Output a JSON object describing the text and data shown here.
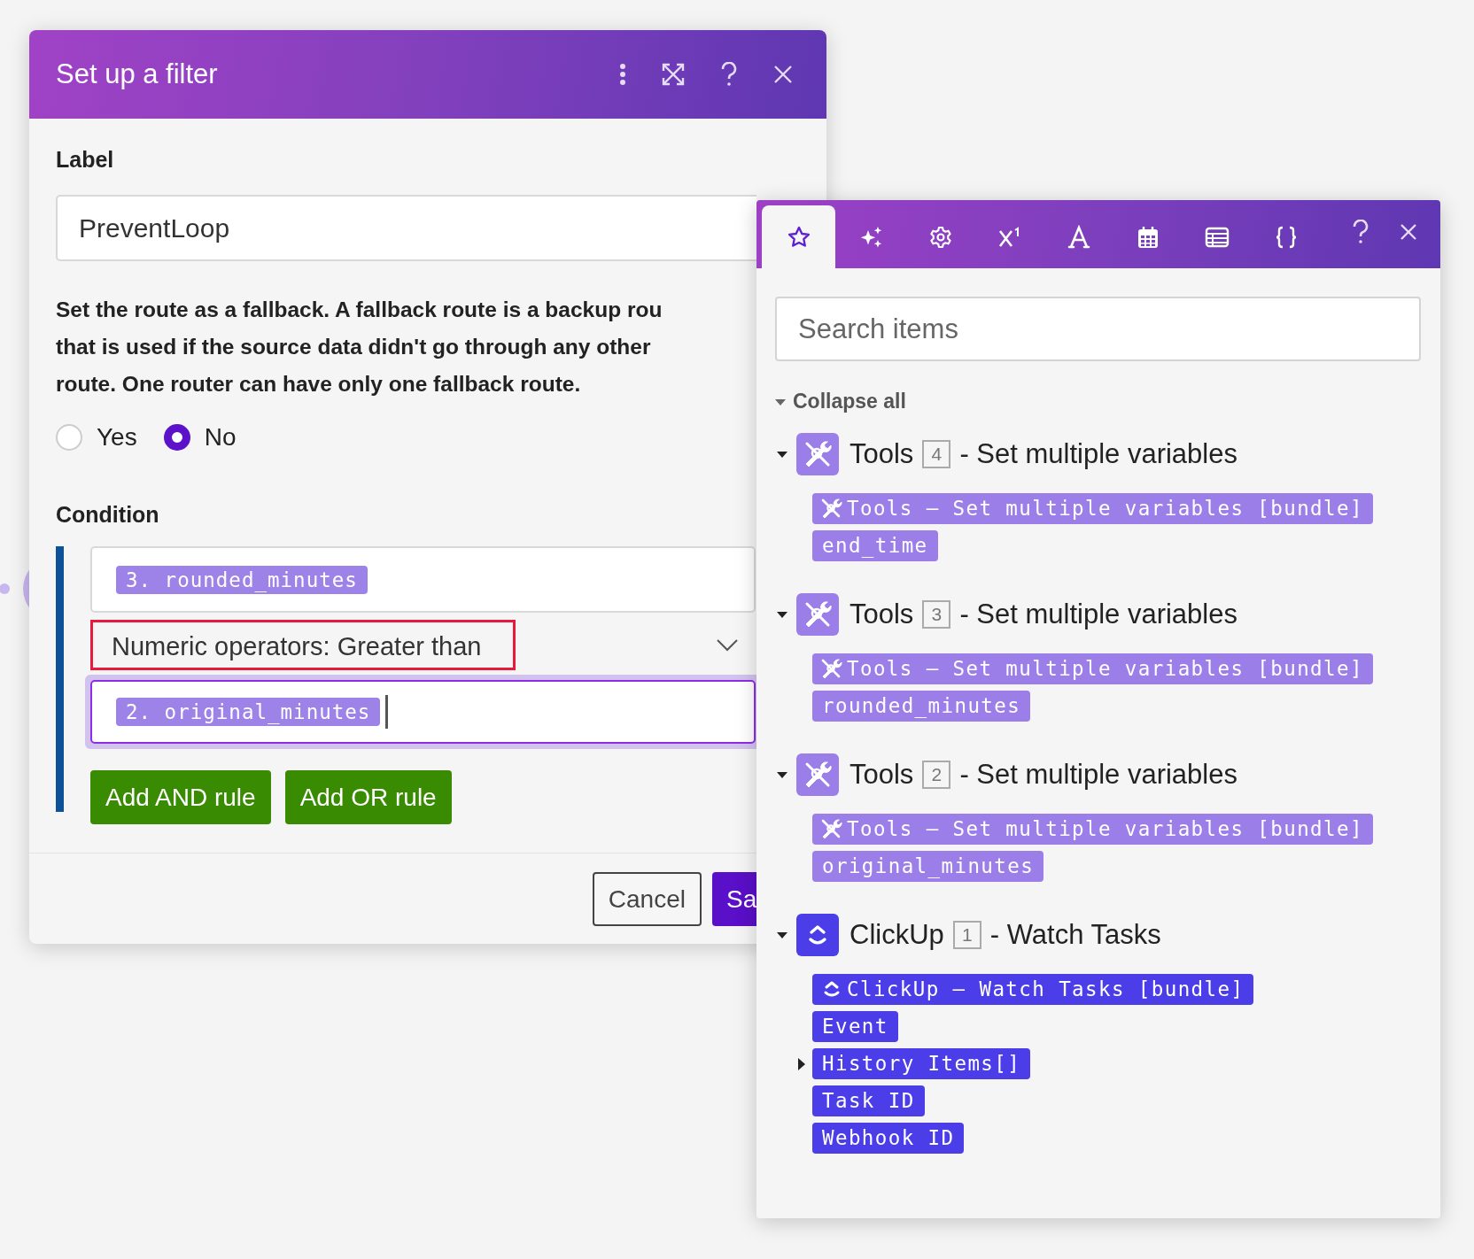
{
  "dialog": {
    "title": "Set up a filter",
    "label": {
      "caption": "Label",
      "value": "PreventLoop"
    },
    "fallback": {
      "lines": [
        "Set the route as a fallback. A fallback route is a backup rou",
        "that is used if the source data didn't go through any other",
        "route. One router can have only one fallback route."
      ],
      "options": [
        {
          "label": "Yes",
          "selected": false
        },
        {
          "label": "No",
          "selected": true
        }
      ]
    },
    "condition": {
      "caption": "Condition",
      "left_operand": "3. rounded_minutes",
      "operator": {
        "text": "Numeric operators: Greater than",
        "highlighted": true
      },
      "right_operand": {
        "text": "2. original_minutes",
        "focused": true
      }
    },
    "rule_buttons": [
      "Add AND rule",
      "Add OR rule"
    ],
    "footer_buttons": [
      {
        "label": "Cancel",
        "kind": "secondary"
      },
      {
        "label": "Sa",
        "kind": "primary"
      }
    ]
  },
  "panel": {
    "tabs": [
      {
        "kind": "star",
        "selected": true
      },
      {
        "kind": "sparkles",
        "selected": false
      },
      {
        "kind": "gear",
        "selected": false
      },
      {
        "kind": "superscript",
        "selected": false
      },
      {
        "kind": "text",
        "selected": false
      },
      {
        "kind": "calendar",
        "selected": false
      },
      {
        "kind": "table",
        "selected": false
      },
      {
        "kind": "braces",
        "selected": false
      }
    ],
    "search": {
      "placeholder": "Search items"
    },
    "collapse_all": "Collapse all",
    "modules": [
      {
        "kind": "tools",
        "app": "Tools",
        "number": "4",
        "action": "- Set multiple variables",
        "color": "#9b7ee8",
        "expanded": true,
        "bundle": "Tools – Set multiple variables [bundle]",
        "fields": [
          {
            "name": "end_time",
            "kind": "value"
          }
        ]
      },
      {
        "kind": "tools",
        "app": "Tools",
        "number": "3",
        "action": "- Set multiple variables",
        "color": "#9b7ee8",
        "expanded": true,
        "bundle": "Tools – Set multiple variables [bundle]",
        "fields": [
          {
            "name": "rounded_minutes",
            "kind": "value"
          }
        ]
      },
      {
        "kind": "tools",
        "app": "Tools",
        "number": "2",
        "action": "- Set multiple variables",
        "color": "#9b7ee8",
        "expanded": true,
        "bundle": "Tools – Set multiple variables [bundle]",
        "fields": [
          {
            "name": "original_minutes",
            "kind": "value"
          }
        ]
      },
      {
        "kind": "clickup",
        "app": "ClickUp",
        "number": "1",
        "action": "- Watch Tasks",
        "color": "#4b3de8",
        "expanded": true,
        "bundle": "ClickUp – Watch Tasks [bundle]",
        "fields": [
          {
            "name": "Event",
            "kind": "value"
          },
          {
            "name": "History Items[]",
            "kind": "collection"
          },
          {
            "name": "Task ID",
            "kind": "value"
          },
          {
            "name": "Webhook ID",
            "kind": "value"
          }
        ]
      }
    ]
  }
}
